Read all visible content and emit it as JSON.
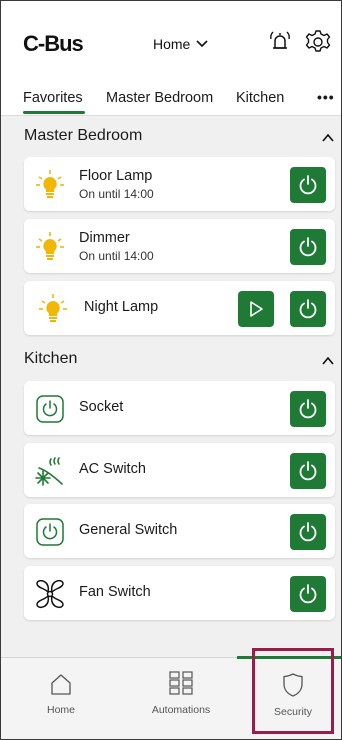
{
  "app": {
    "logo_text": "C-Bus",
    "location_select": "Home"
  },
  "header_icons": [
    "alarm-bell-icon",
    "gear-icon"
  ],
  "tabs": [
    {
      "label": "Favorites",
      "active": true
    },
    {
      "label": "Master Bedroom",
      "active": false
    },
    {
      "label": "Kitchen",
      "active": false
    }
  ],
  "tabs_more": "•••",
  "sections": {
    "master_bedroom": {
      "title": "Master Bedroom",
      "devices": [
        {
          "name": "Floor Lamp",
          "status": "On until 14:00",
          "icon": "bulb-lit-icon"
        },
        {
          "name": "Dimmer",
          "status": "On until 14:00",
          "icon": "bulb-lit-icon"
        },
        {
          "name": "Night Lamp",
          "status": "",
          "icon": "bulb-lit-icon",
          "extra": "play-icon"
        }
      ]
    },
    "kitchen": {
      "title": "Kitchen",
      "devices": [
        {
          "name": "Socket",
          "icon": "power-switch-icon"
        },
        {
          "name": "AC Switch",
          "icon": "ac-snowflake-icon"
        },
        {
          "name": "General Switch",
          "icon": "power-switch-icon"
        },
        {
          "name": "Fan Switch",
          "icon": "fan-icon"
        }
      ]
    }
  },
  "bottom_nav": [
    {
      "label": "Home",
      "icon": "home-icon"
    },
    {
      "label": "Automations",
      "icon": "grid-icon"
    },
    {
      "label": "Security",
      "icon": "shield-icon",
      "active": true
    }
  ],
  "colors": {
    "accent_green": "#1e7a34",
    "bulb_yellow": "#f2b705",
    "highlight": "#9b1b4a"
  }
}
